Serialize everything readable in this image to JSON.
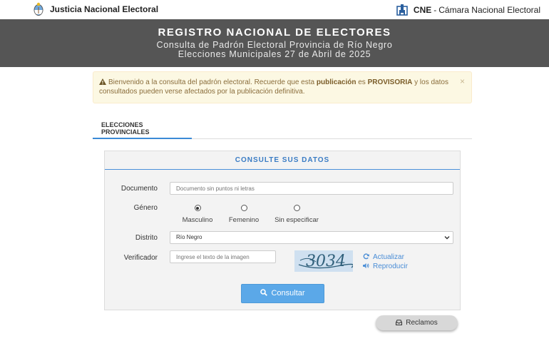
{
  "topbar": {
    "left_title": "Justicia Nacional Electoral",
    "right_abbr": "CNE",
    "right_separator": "-",
    "right_title": "Cámara Nacional Electoral",
    "left_icon": "argentina-crest-icon",
    "right_icon": "cne-building-icon"
  },
  "header": {
    "title": "REGISTRO NACIONAL DE ELECTORES",
    "subtitle": "Consulta de Padrón Electoral Provincia de Río Negro",
    "election": "Elecciones Municipales 27 de Abril de 2025"
  },
  "alert": {
    "text_1": "Bienvenido a la consulta del padrón electoral. Recuerde que esta ",
    "bold_1": "publicación",
    "text_2": " es ",
    "bold_2": "PROVISORIA",
    "text_3": " y los datos consultados pueden verse afectados por la publicación definitiva.",
    "close": "×"
  },
  "tabs": [
    {
      "label": "ELECCIONES PROVINCIALES",
      "active": true
    }
  ],
  "form": {
    "heading": "CONSULTE SUS DATOS",
    "documento_label": "Documento",
    "documento_placeholder": "Documento sin puntos ni letras",
    "genero_label": "Género",
    "genero_options": [
      {
        "label": "Masculino",
        "selected": true
      },
      {
        "label": "Femenino",
        "selected": false
      },
      {
        "label": "Sin especificar",
        "selected": false
      }
    ],
    "distrito_label": "Distrito",
    "distrito_value": "Río Negro",
    "verificador_label": "Verificador",
    "verificador_placeholder": "Ingrese el texto de la imagen",
    "captcha_text": "3034",
    "refresh_label": "Actualizar",
    "play_label": "Reproducir",
    "submit_label": "Consultar"
  },
  "footer": {
    "reclamos_label": "Reclamos"
  },
  "colors": {
    "banner_bg": "#555555",
    "accent_blue": "#3a8ad6",
    "button_blue": "#5ba8e8",
    "alert_bg": "#fcf8e3",
    "alert_text": "#8a6d3b"
  }
}
